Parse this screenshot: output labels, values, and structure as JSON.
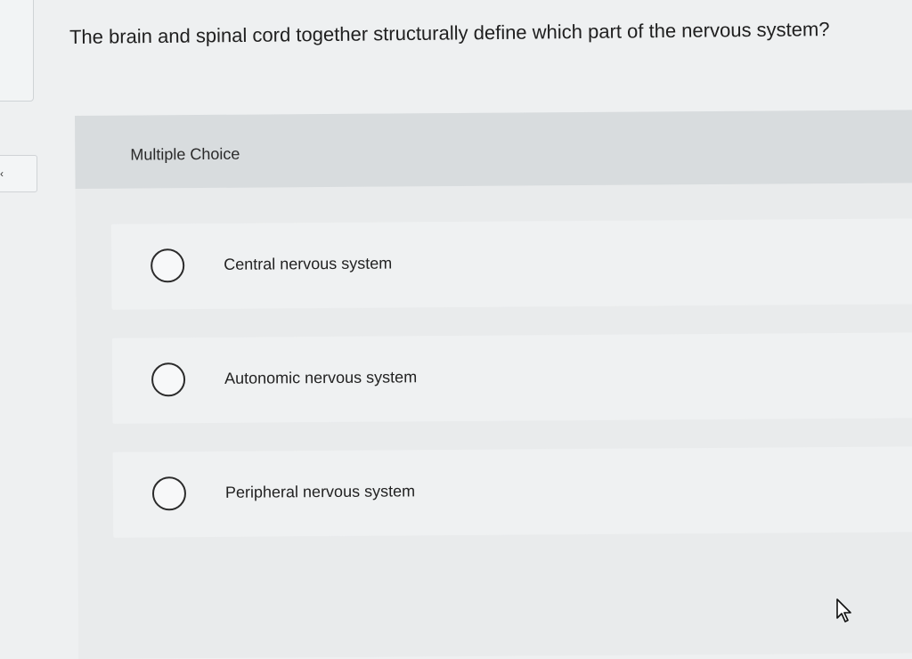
{
  "question": {
    "text": "The brain and spinal cord together structurally define which part of the nervous system?"
  },
  "left_panel": {
    "collapse_icon": "‹"
  },
  "card": {
    "header_label": "Multiple Choice",
    "options": [
      {
        "label": "Central nervous system",
        "selected": false
      },
      {
        "label": "Autonomic nervous system",
        "selected": false
      },
      {
        "label": "Peripheral nervous system",
        "selected": false
      }
    ]
  },
  "icons": {
    "radio": "radio-empty-icon",
    "cursor": "mouse-pointer-icon",
    "collapse": "chevron-left-icon"
  }
}
